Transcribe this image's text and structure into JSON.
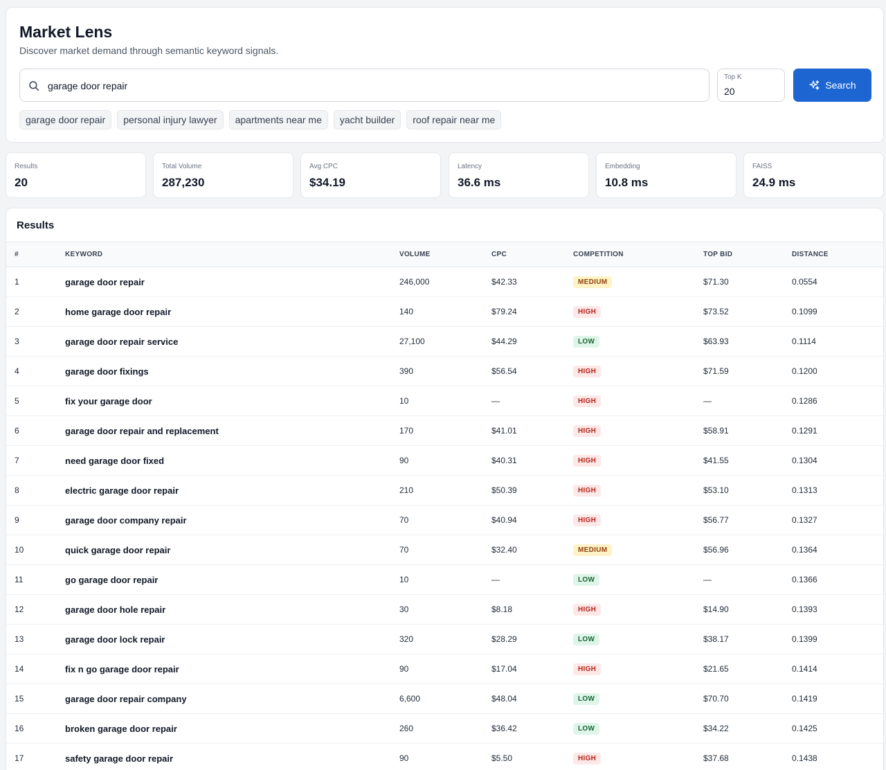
{
  "app": {
    "title": "Market Lens",
    "subtitle": "Discover market demand through semantic keyword signals."
  },
  "search": {
    "query": "garage door repair",
    "topk_label": "Top K",
    "topk_value": "20",
    "button_label": "Search",
    "icons": {
      "search": "search-icon",
      "button": "sparkles-icon"
    }
  },
  "suggestions": [
    "garage door repair",
    "personal injury lawyer",
    "apartments near me",
    "yacht builder",
    "roof repair near me"
  ],
  "stats": [
    {
      "label": "Results",
      "value": "20"
    },
    {
      "label": "Total Volume",
      "value": "287,230"
    },
    {
      "label": "Avg CPC",
      "value": "$34.19"
    },
    {
      "label": "Latency",
      "value": "36.6 ms"
    },
    {
      "label": "Embedding",
      "value": "10.8 ms"
    },
    {
      "label": "FAISS",
      "value": "24.9 ms"
    }
  ],
  "results": {
    "title": "Results",
    "columns": [
      "#",
      "KEYWORD",
      "VOLUME",
      "CPC",
      "COMPETITION",
      "TOP BID",
      "DISTANCE"
    ],
    "rows": [
      {
        "n": "1",
        "keyword": "garage door repair",
        "volume": "246,000",
        "cpc": "$42.33",
        "competition": "MEDIUM",
        "top_bid": "$71.30",
        "distance": "0.0554"
      },
      {
        "n": "2",
        "keyword": "home garage door repair",
        "volume": "140",
        "cpc": "$79.24",
        "competition": "HIGH",
        "top_bid": "$73.52",
        "distance": "0.1099"
      },
      {
        "n": "3",
        "keyword": "garage door repair service",
        "volume": "27,100",
        "cpc": "$44.29",
        "competition": "LOW",
        "top_bid": "$63.93",
        "distance": "0.1114"
      },
      {
        "n": "4",
        "keyword": "garage door fixings",
        "volume": "390",
        "cpc": "$56.54",
        "competition": "HIGH",
        "top_bid": "$71.59",
        "distance": "0.1200"
      },
      {
        "n": "5",
        "keyword": "fix your garage door",
        "volume": "10",
        "cpc": "—",
        "competition": "HIGH",
        "top_bid": "—",
        "distance": "0.1286"
      },
      {
        "n": "6",
        "keyword": "garage door repair and replacement",
        "volume": "170",
        "cpc": "$41.01",
        "competition": "HIGH",
        "top_bid": "$58.91",
        "distance": "0.1291"
      },
      {
        "n": "7",
        "keyword": "need garage door fixed",
        "volume": "90",
        "cpc": "$40.31",
        "competition": "HIGH",
        "top_bid": "$41.55",
        "distance": "0.1304"
      },
      {
        "n": "8",
        "keyword": "electric garage door repair",
        "volume": "210",
        "cpc": "$50.39",
        "competition": "HIGH",
        "top_bid": "$53.10",
        "distance": "0.1313"
      },
      {
        "n": "9",
        "keyword": "garage door company repair",
        "volume": "70",
        "cpc": "$40.94",
        "competition": "HIGH",
        "top_bid": "$56.77",
        "distance": "0.1327"
      },
      {
        "n": "10",
        "keyword": "quick garage door repair",
        "volume": "70",
        "cpc": "$32.40",
        "competition": "MEDIUM",
        "top_bid": "$56.96",
        "distance": "0.1364"
      },
      {
        "n": "11",
        "keyword": "go garage door repair",
        "volume": "10",
        "cpc": "—",
        "competition": "LOW",
        "top_bid": "—",
        "distance": "0.1366"
      },
      {
        "n": "12",
        "keyword": "garage door hole repair",
        "volume": "30",
        "cpc": "$8.18",
        "competition": "HIGH",
        "top_bid": "$14.90",
        "distance": "0.1393"
      },
      {
        "n": "13",
        "keyword": "garage door lock repair",
        "volume": "320",
        "cpc": "$28.29",
        "competition": "LOW",
        "top_bid": "$38.17",
        "distance": "0.1399"
      },
      {
        "n": "14",
        "keyword": "fix n go garage door repair",
        "volume": "90",
        "cpc": "$17.04",
        "competition": "HIGH",
        "top_bid": "$21.65",
        "distance": "0.1414"
      },
      {
        "n": "15",
        "keyword": "garage door repair company",
        "volume": "6,600",
        "cpc": "$48.04",
        "competition": "LOW",
        "top_bid": "$70.70",
        "distance": "0.1419"
      },
      {
        "n": "16",
        "keyword": "broken garage door repair",
        "volume": "260",
        "cpc": "$36.42",
        "competition": "LOW",
        "top_bid": "$34.22",
        "distance": "0.1425"
      },
      {
        "n": "17",
        "keyword": "safety garage door repair",
        "volume": "90",
        "cpc": "$5.50",
        "competition": "HIGH",
        "top_bid": "$37.68",
        "distance": "0.1438"
      }
    ]
  },
  "colors": {
    "accent": "#1d66d2",
    "high": "#b42318",
    "medium": "#92400e",
    "low": "#166534"
  }
}
